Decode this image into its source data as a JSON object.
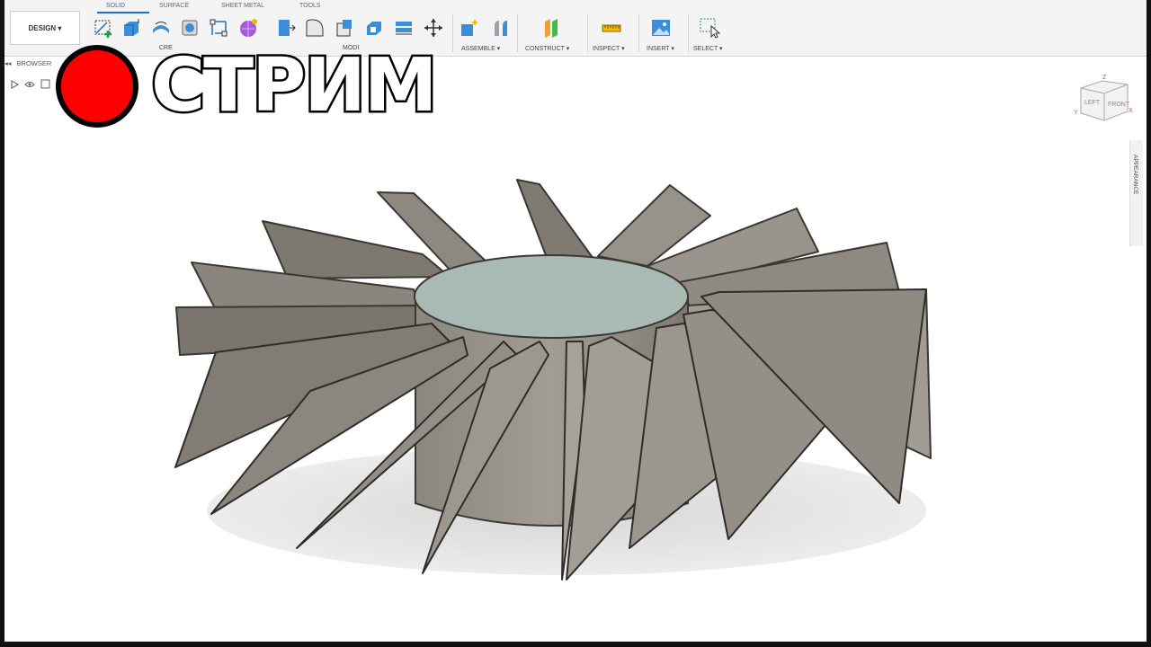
{
  "toolbar": {
    "workspace_label": "DESIGN ▾",
    "tabs": [
      "SOLID",
      "SURFACE",
      "SHEET METAL",
      "TOOLS"
    ],
    "groups": {
      "create": "CRE",
      "modify": "MODI",
      "assemble": "ASSEMBLE ▾",
      "construct": "CONSTRUCT ▾",
      "inspect": "INSPECT ▾",
      "insert": "INSERT ▾",
      "select": "SELECT ▾"
    }
  },
  "browser": {
    "title": "BROWSER"
  },
  "overlay": {
    "title": "СТРИМ",
    "dot_color": "#ff0000"
  },
  "viewcube": {
    "left": "LEFT",
    "front": "FRONT",
    "axis_z": "Z",
    "axis_x": "X",
    "axis_y": "Y"
  },
  "appearance_panel": {
    "label": "APPEARANCE"
  },
  "colors": {
    "accent": "#1e6fc1",
    "blade": "#8f8a82",
    "hub_top": "#a9b9b4"
  }
}
